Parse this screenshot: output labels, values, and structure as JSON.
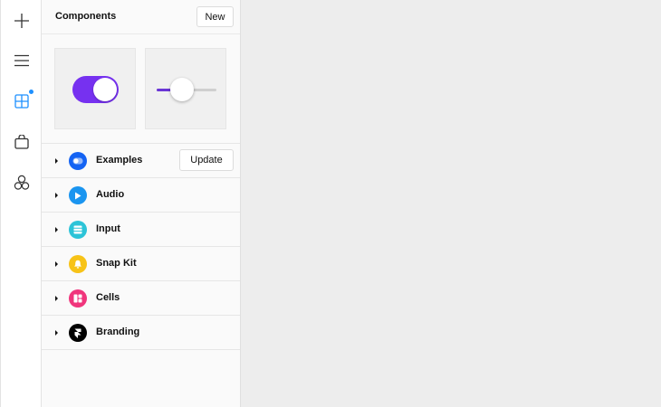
{
  "rail": {
    "items": [
      {
        "icon": "plus-icon"
      },
      {
        "icon": "menu-icon"
      },
      {
        "icon": "grid-icon",
        "badge": true
      },
      {
        "icon": "bag-icon"
      },
      {
        "icon": "circles-icon"
      }
    ],
    "active_color": "#1e90ff"
  },
  "panel": {
    "title": "Components",
    "new_label": "New"
  },
  "previews": {
    "toggle": {
      "on": true,
      "color": "#7631f0"
    },
    "slider": {
      "value": 0.43,
      "color": "#6a35d6"
    }
  },
  "list": {
    "items": [
      {
        "label": "Examples",
        "icon": "toggle-icon",
        "color": "#1463f3",
        "action": "Update"
      },
      {
        "label": "Audio",
        "icon": "play-icon",
        "color": "#1a95f0"
      },
      {
        "label": "Input",
        "icon": "input-icon",
        "color": "#2cc4d8"
      },
      {
        "label": "Snap Kit",
        "icon": "bell-icon",
        "color": "#f7c318"
      },
      {
        "label": "Cells",
        "icon": "cells-icon",
        "color": "#f0357c"
      },
      {
        "label": "Branding",
        "icon": "framer-icon",
        "color": "#000000"
      }
    ]
  }
}
